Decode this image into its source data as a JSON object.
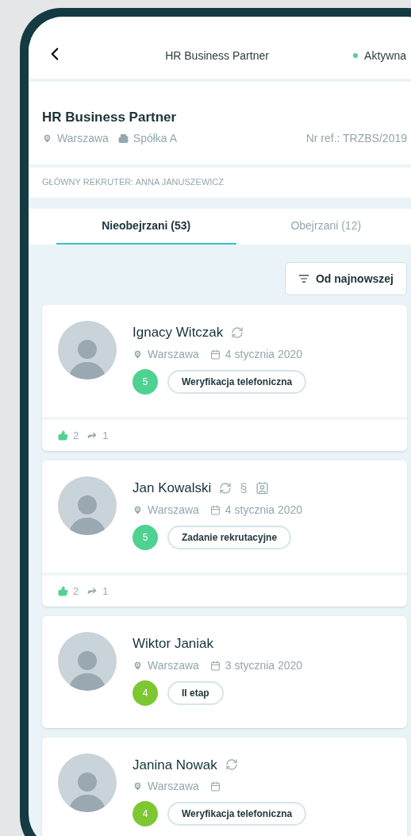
{
  "top_bar": {
    "title": "HR Business Partner",
    "status": "Aktywna"
  },
  "job": {
    "title": "HR Business Partner",
    "location": "Warszawa",
    "company": "Spółka A",
    "reference": "Nr ref.: TRZBS/2019"
  },
  "recruiter": "GŁÓWNY REKRUTER: ANNA JANUSZEWICZ",
  "tabs": [
    {
      "label": "Nieobejrzani (53)",
      "selected": true
    },
    {
      "label": "Obejrzani (12)",
      "selected": false
    }
  ],
  "sort_button": "Od najnowszej",
  "candidates": [
    {
      "name": "Ignacy Witczak",
      "icons": [
        {
          "kind": "sync"
        }
      ],
      "location": "Warszawa",
      "date": "4 stycznia 2020",
      "score": "5",
      "color": "#4fd191",
      "stage": "Weryfikacja telefoniczna",
      "likes": "2",
      "shares": "1"
    },
    {
      "name": "Jan Kowalski",
      "icons": [
        {
          "kind": "sync"
        },
        {
          "kind": "text",
          "text": "§"
        },
        {
          "kind": "badge"
        }
      ],
      "location": "Warszawa",
      "date": "4 stycznia 2020",
      "score": "5",
      "color": "#4fd191",
      "stage": "Zadanie rekrutacyjne",
      "likes": "2",
      "shares": "1"
    },
    {
      "name": "Wiktor Janiak",
      "location": "Warszawa",
      "date": "3 stycznia 2020",
      "score": "4",
      "color": "#7dc832",
      "stage": "II etap"
    },
    {
      "name": "Janina Nowak",
      "icons": [
        {
          "kind": "sync"
        }
      ],
      "location": "Warszawa",
      "score": "4",
      "color": "#7dc832",
      "stage": "Weryfikacja telefoniczna"
    }
  ]
}
